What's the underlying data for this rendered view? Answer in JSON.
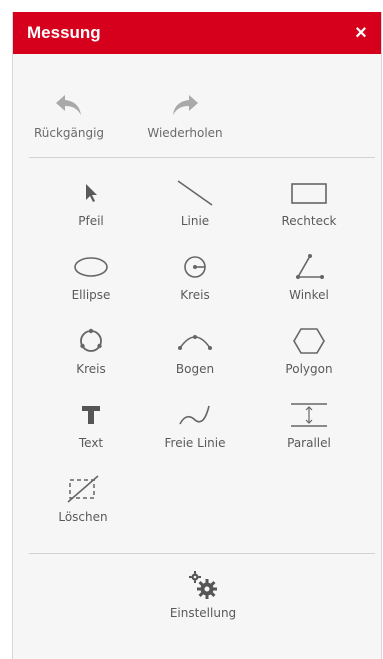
{
  "panel": {
    "title": "Messung",
    "close_glyph": "×"
  },
  "history": [
    {
      "name": "undo",
      "label": "Rückgängig",
      "icon": "undo-arrow-icon"
    },
    {
      "name": "redo",
      "label": "Wiederholen",
      "icon": "redo-arrow-icon"
    }
  ],
  "tools": {
    "arrow": "Pfeil",
    "line": "Linie",
    "rectangle": "Rechteck",
    "ellipse": "Ellipse",
    "circle_center": "Kreis",
    "angle": "Winkel",
    "circle_points": "Kreis",
    "arc": "Bogen",
    "polygon": "Polygon",
    "text": "Text",
    "freehand": "Freie Linie",
    "parallel": "Parallel",
    "delete": "Löschen"
  },
  "settings": {
    "label": "Einstellung",
    "icon": "gears-icon"
  },
  "colors": {
    "header": "#d6001c",
    "icon": "#666666",
    "disabled_icon": "#a9a9a9"
  }
}
